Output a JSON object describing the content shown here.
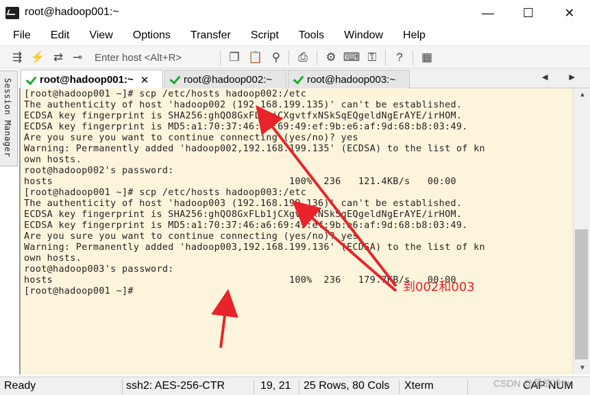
{
  "window": {
    "title": "root@hadoop001:~",
    "minimize": "—",
    "maximize": "☐",
    "close": "✕"
  },
  "menu": [
    "File",
    "Edit",
    "View",
    "Options",
    "Transfer",
    "Script",
    "Tools",
    "Window",
    "Help"
  ],
  "toolbar": {
    "host_placeholder": "Enter host <Alt+R>",
    "icons": [
      "connect-icon",
      "lightning-icon",
      "reconnect-icon",
      "link-icon",
      "copy-icon",
      "paste-icon",
      "find-icon",
      "print-icon",
      "settings-icon",
      "keymap-icon",
      "sftp-icon",
      "help-icon",
      "map-icon"
    ]
  },
  "session_manager": "Session Manager",
  "tabs": [
    {
      "label": "root@hadoop001:~",
      "active": true,
      "close": "✕"
    },
    {
      "label": "root@hadoop002:~",
      "active": false
    },
    {
      "label": "root@hadoop003:~",
      "active": false
    }
  ],
  "tab_nav": "◀ ▶",
  "terminal": {
    "lines": [
      "[root@hadoop001 ~]# scp /etc/hosts hadoop002:/etc",
      "The authenticity of host 'hadoop002 (192.168.199.135)' can't be established.",
      "ECDSA key fingerprint is SHA256:ghQO8GxFLb1jCXgvtfxNSkSqEQgeldNgErAYE/irHOM.",
      "ECDSA key fingerprint is MD5:a1:70:37:46:a6:69:49:ef:9b:e6:af:9d:68:b8:03:49.",
      "Are you sure you want to continue connecting (yes/no)? yes",
      "Warning: Permanently added 'hadoop002,192.168.199.135' (ECDSA) to the list of kn",
      "own hosts.",
      "root@hadoop002's password:",
      "hosts                                         100%  236   121.4KB/s   00:00",
      "[root@hadoop001 ~]# scp /etc/hosts hadoop003:/etc",
      "The authenticity of host 'hadoop003 (192.168.199.136)' can't be established.",
      "ECDSA key fingerprint is SHA256:ghQO8GxFLb1jCXgvtfxNSkSqEQgeldNgErAYE/irHOM.",
      "ECDSA key fingerprint is MD5:a1:70:37:46:a6:69:49:ef:9b:e6:af:9d:68:b8:03:49.",
      "Are you sure you want to continue connecting (yes/no)? yes",
      "Warning: Permanently added 'hadoop003,192.168.199.136' (ECDSA) to the list of kn",
      "own hosts.",
      "root@hadoop003's password:",
      "hosts                                         100%  236   179.7KB/s   00:00",
      "[root@hadoop001 ~]#"
    ]
  },
  "annotation": {
    "text": "到002和003",
    "color": "#e8232a"
  },
  "scrollbar": {
    "up": "▲",
    "down": "▼"
  },
  "status": {
    "state": "Ready",
    "cipher": "ssh2: AES-256-CTR",
    "cursor": "19,  21",
    "size": "25 Rows, 80 Cols",
    "term": "Xterm",
    "caps": "CAP",
    "num": "NUM"
  },
  "watermark": "CSDN @星欲冷hx"
}
